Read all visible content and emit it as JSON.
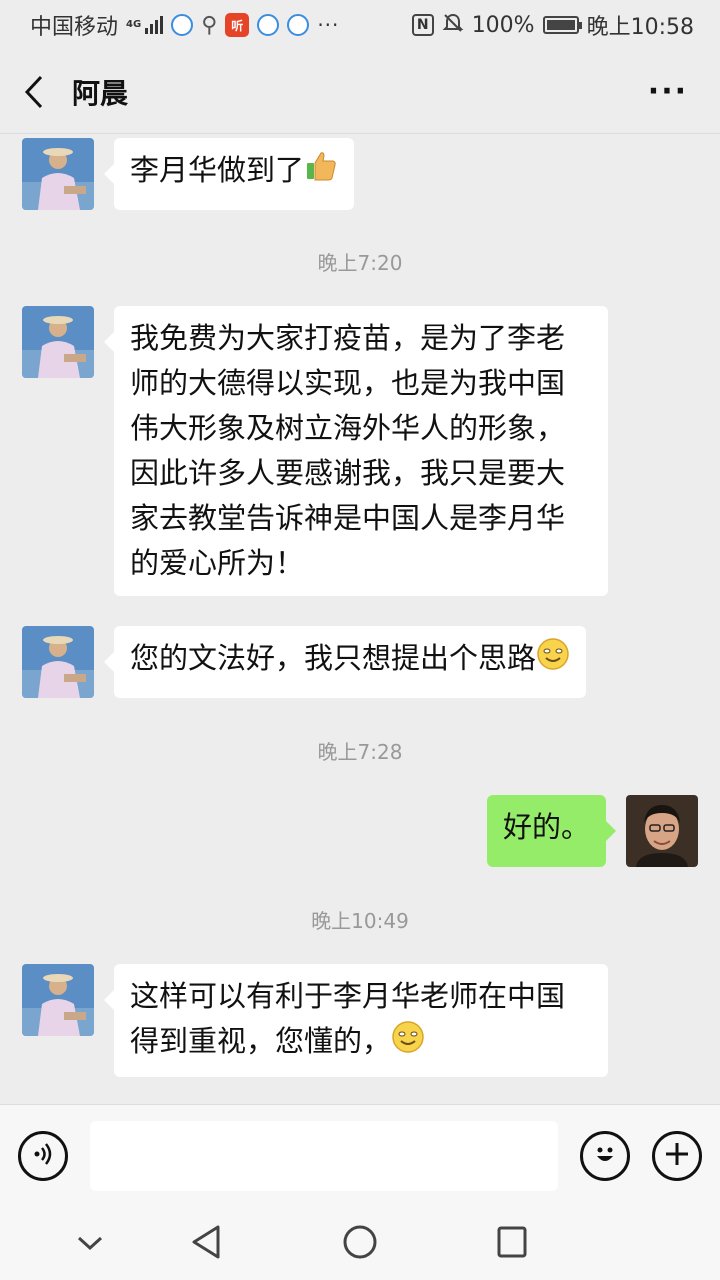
{
  "status_bar": {
    "carrier": "中国移动",
    "network": "4G",
    "battery": "100%",
    "time": "晚上10:58",
    "app_icon_red_label": "听",
    "more": "···"
  },
  "header": {
    "title": "阿晨"
  },
  "messages": [
    {
      "side": "left",
      "text": "李月华做到了"
    },
    {
      "type": "time",
      "text": "晚上7:20"
    },
    {
      "side": "left",
      "text": "我免费为大家打疫苗，是为了李老师的大德得以实现，也是为我中国伟大形象及树立海外华人的形象，因此许多人要感谢我，我只是要大家去教堂告诉神是中国人是李月华的爱心所为！"
    },
    {
      "side": "left",
      "text": "您的文法好，我只想提出个思路"
    },
    {
      "type": "time",
      "text": "晚上7:28"
    },
    {
      "side": "right",
      "text": "好的。"
    },
    {
      "type": "time",
      "text": "晚上10:49"
    },
    {
      "side": "left",
      "text": "这样可以有利于李月华老师在中国得到重视，您懂的，"
    }
  ],
  "input": {
    "value": "",
    "placeholder": ""
  },
  "colors": {
    "sent_bubble": "#95ec69",
    "received_bubble": "#ffffff",
    "background": "#ededed"
  }
}
